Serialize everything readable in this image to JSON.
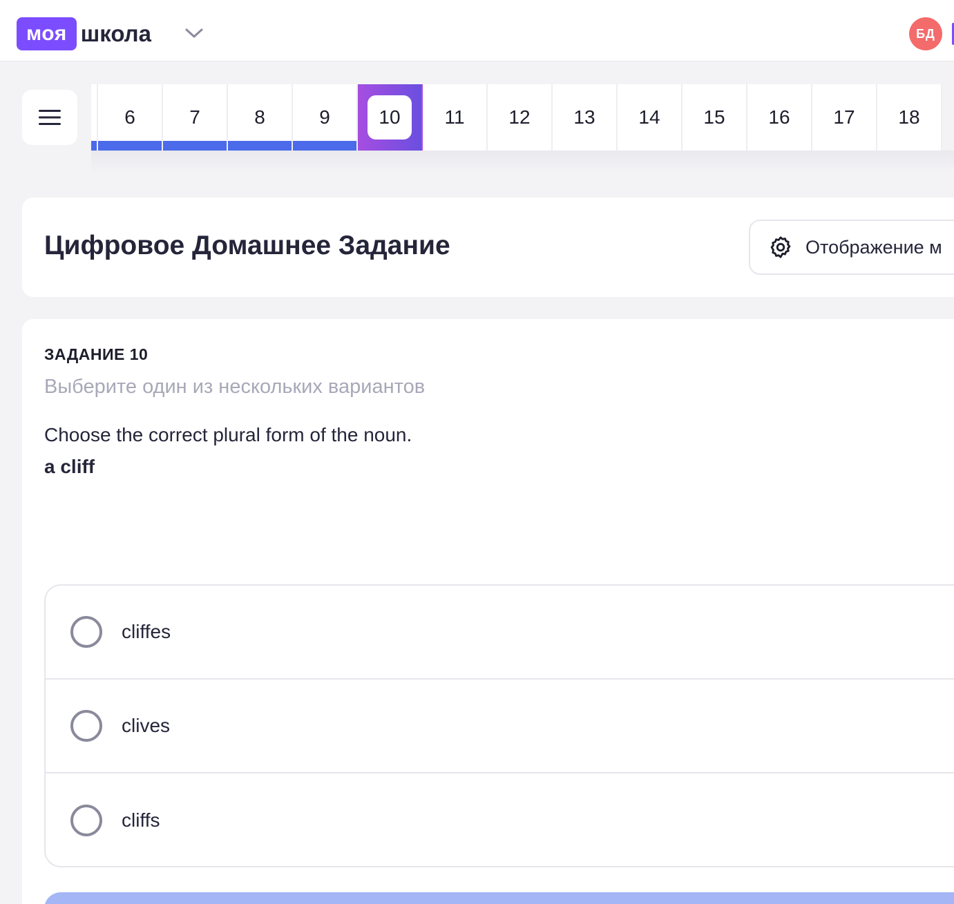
{
  "header": {
    "logo_part1": "моя",
    "logo_part2": "школа",
    "avatar_initials": "БД"
  },
  "task_nav": {
    "items": [
      {
        "label": "6",
        "state": "done"
      },
      {
        "label": "7",
        "state": "done"
      },
      {
        "label": "8",
        "state": "done"
      },
      {
        "label": "9",
        "state": "done"
      },
      {
        "label": "10",
        "state": "current"
      },
      {
        "label": "11",
        "state": "todo"
      },
      {
        "label": "12",
        "state": "todo"
      },
      {
        "label": "13",
        "state": "todo"
      },
      {
        "label": "14",
        "state": "todo"
      },
      {
        "label": "15",
        "state": "todo"
      },
      {
        "label": "16",
        "state": "todo"
      },
      {
        "label": "17",
        "state": "todo"
      },
      {
        "label": "18",
        "state": "todo"
      }
    ]
  },
  "page": {
    "title": "Цифровое Домашнее Задание",
    "display_button": "Отображение м"
  },
  "task": {
    "number_label": "ЗАДАНИЕ 10",
    "hint": "Выберите один из нескольких вариантов",
    "question": "Choose the correct plural form of the noun.",
    "word": "a cliff",
    "options": [
      {
        "label": "cliffes",
        "selected": false
      },
      {
        "label": "clives",
        "selected": false
      },
      {
        "label": "cliffs",
        "selected": false
      }
    ]
  },
  "colors": {
    "brand": "#7c4dff",
    "progress_done": "#4b6bea",
    "current_gradient_start": "#a64ee0",
    "current_gradient_end": "#6a4fe0",
    "avatar": "#f46b6b",
    "submit_disabled": "#a4b6f5"
  },
  "icons": {
    "menu": "hamburger-icon",
    "logo_dropdown": "chevron-down-icon",
    "display_settings": "gear-icon"
  }
}
